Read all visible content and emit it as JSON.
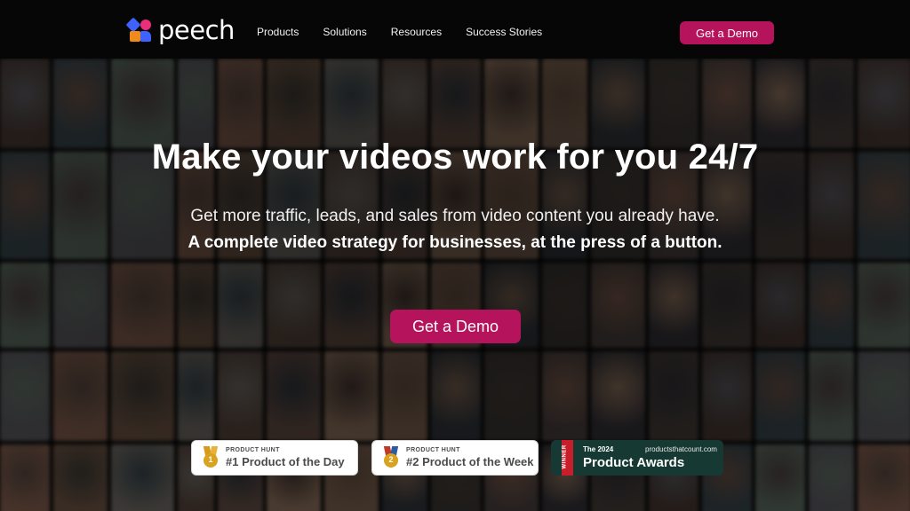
{
  "brand": {
    "name": "peech"
  },
  "nav": {
    "items": [
      "Products",
      "Solutions",
      "Resources",
      "Success Stories"
    ],
    "cta": "Get a Demo"
  },
  "hero": {
    "headline": "Make your videos work for you 24/7",
    "subtitle": "Get more traffic, leads, and sales from video content you already have.",
    "tagline": "A complete video strategy for businesses, at the press of a button.",
    "cta": "Get a Demo"
  },
  "badges": {
    "product_hunt_1": {
      "source": "PRODUCT HUNT",
      "title": "#1 Product of the Day",
      "rank": "1",
      "medal": "gold"
    },
    "product_hunt_2": {
      "source": "PRODUCT HUNT",
      "title": "#2 Product of the Week",
      "rank": "2",
      "medal": "gold"
    },
    "award": {
      "ribbon": "WINNER",
      "year": "The 2024",
      "site": "productsthatcount.com",
      "title": "Product Awards"
    }
  },
  "colors": {
    "accent": "#b5135c",
    "nav_bg": "#060606",
    "award_bg": "#163a33"
  }
}
